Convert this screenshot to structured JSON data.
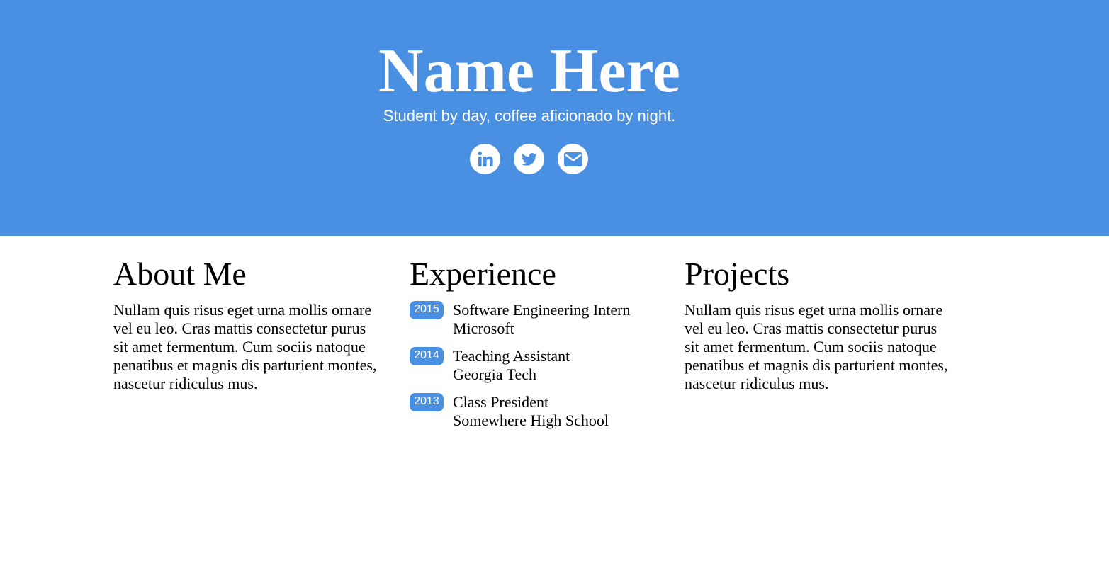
{
  "colors": {
    "accent": "#4a90e2",
    "hero_text": "#ffffff",
    "body_text": "#000000"
  },
  "header": {
    "name": "Name Here",
    "tagline": "Student by day, coffee aficionado by night.",
    "social": [
      {
        "icon": "linkedin-icon"
      },
      {
        "icon": "twitter-icon"
      },
      {
        "icon": "envelope-icon"
      }
    ]
  },
  "about": {
    "title": "About Me",
    "text": "Nullam quis risus eget urna mollis ornare vel eu leo. Cras mattis consectetur purus sit amet fermentum. Cum sociis natoque penatibus et magnis dis parturient montes, nascetur ridiculus mus."
  },
  "experience": {
    "title": "Experience",
    "items": [
      {
        "year": "2015",
        "role": "Software Engineering Intern",
        "org": "Microsoft"
      },
      {
        "year": "2014",
        "role": "Teaching Assistant",
        "org": "Georgia Tech"
      },
      {
        "year": "2013",
        "role": "Class President",
        "org": "Somewhere High School"
      }
    ]
  },
  "projects": {
    "title": "Projects",
    "text": "Nullam quis risus eget urna mollis ornare vel eu leo. Cras mattis consectetur purus sit amet fermentum. Cum sociis natoque penatibus et magnis dis parturient montes, nascetur ridiculus mus."
  }
}
